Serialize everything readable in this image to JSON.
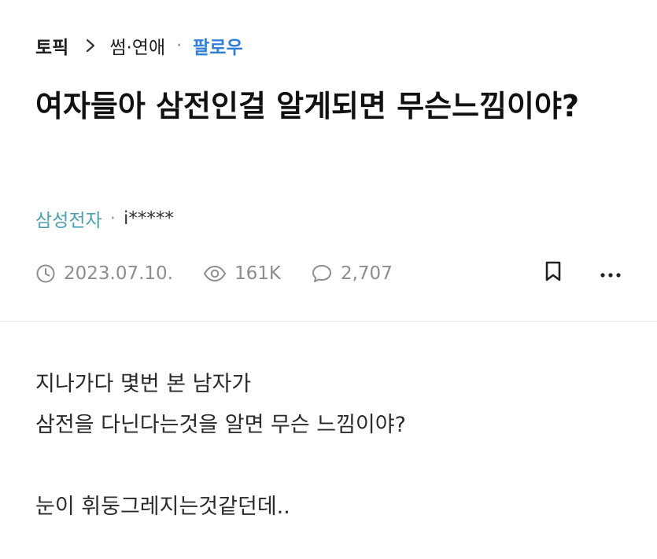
{
  "breadcrumb": {
    "topic": "토픽",
    "category": "썸·연애",
    "separator": "·",
    "follow_label": "팔로우"
  },
  "post": {
    "title": "여자들아 삼전인걸 알게되면 무슨느낌이야?",
    "author": {
      "company": "삼성전자",
      "separator": "·",
      "nickname": "i*****"
    },
    "meta": {
      "date": "2023.07.10.",
      "views": "161K",
      "comments": "2,707"
    },
    "body": {
      "line1": "지나가다 몇번 본 남자가",
      "line2": "삼전을 다닌다는것을 알면 무슨 느낌이야?",
      "line3": "눈이 휘둥그레지는것같던데.."
    }
  },
  "icons": {
    "breadcrumb_chevron": "chevron-right-icon",
    "date": "clock-icon",
    "views": "eye-icon",
    "comments": "speech-bubble-icon",
    "bookmark": "bookmark-icon",
    "more": "more-dots-icon"
  },
  "colors": {
    "follow": "#2f7fd8",
    "company": "#4aa0ae",
    "meta": "#8d8d8d",
    "title": "#111111"
  }
}
